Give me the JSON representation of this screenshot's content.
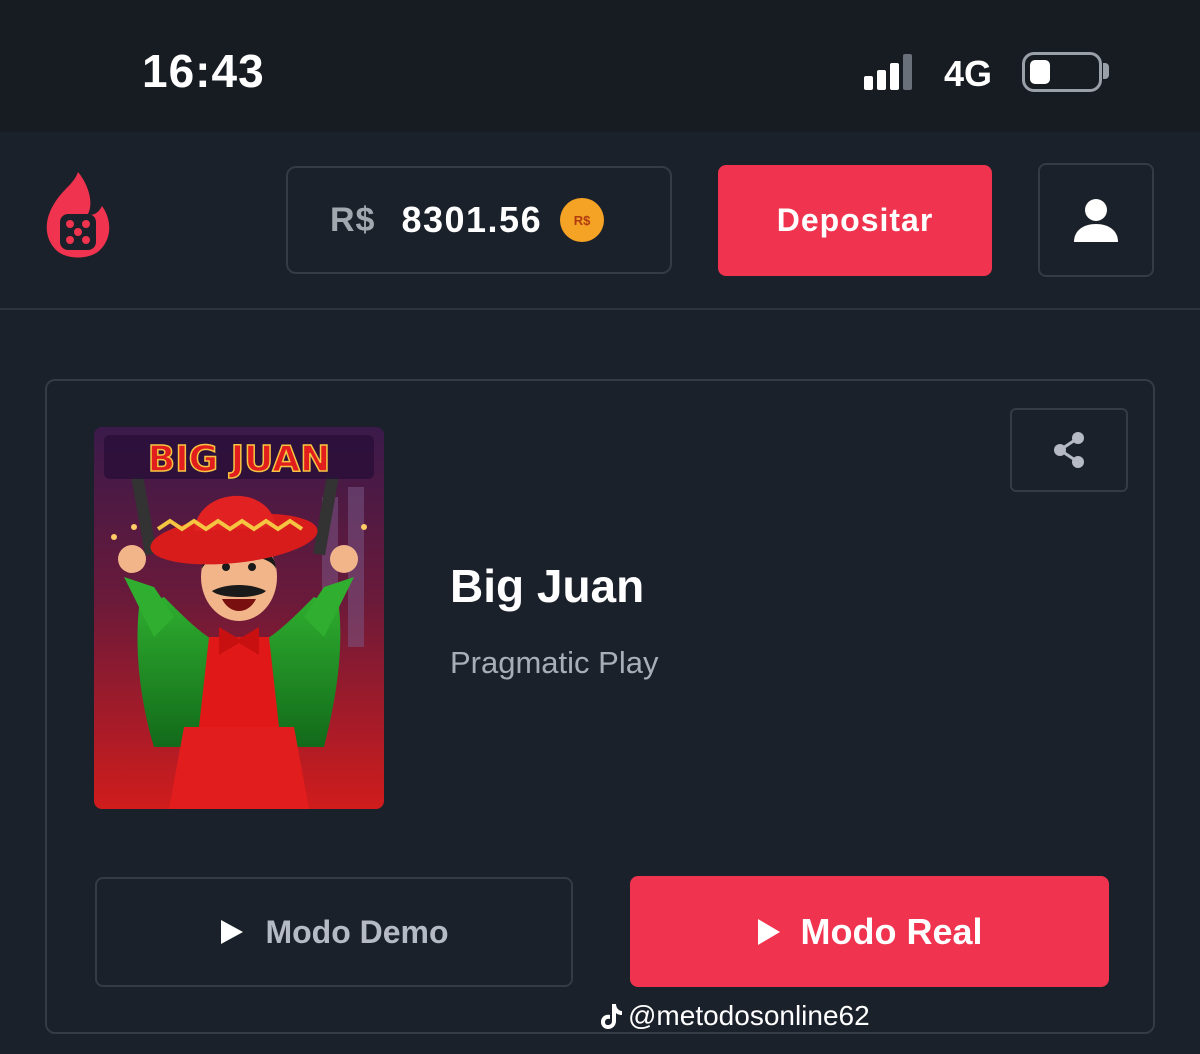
{
  "status_bar": {
    "time": "16:43",
    "network": "4G",
    "signal_bars": 4,
    "signal_active_bars": 3
  },
  "header": {
    "logo_icon": "flame-dice-logo",
    "balance": {
      "currency": "R$",
      "amount": "8301.56",
      "coin_label": "R$"
    },
    "deposit_label": "Depositar",
    "profile_icon": "user-icon"
  },
  "game": {
    "thumbnail_title": "BIG JUAN",
    "title": "Big Juan",
    "provider": "Pragmatic Play",
    "share_icon": "share-icon",
    "demo_label": "Modo Demo",
    "real_label": "Modo Real"
  },
  "watermark": {
    "text": "@metodosonline62",
    "icon": "tiktok-icon"
  },
  "colors": {
    "accent": "#f0334e",
    "background": "#1b212a",
    "status_bar": "#171b22",
    "border": "#343b45",
    "coin": "#f5a324"
  }
}
